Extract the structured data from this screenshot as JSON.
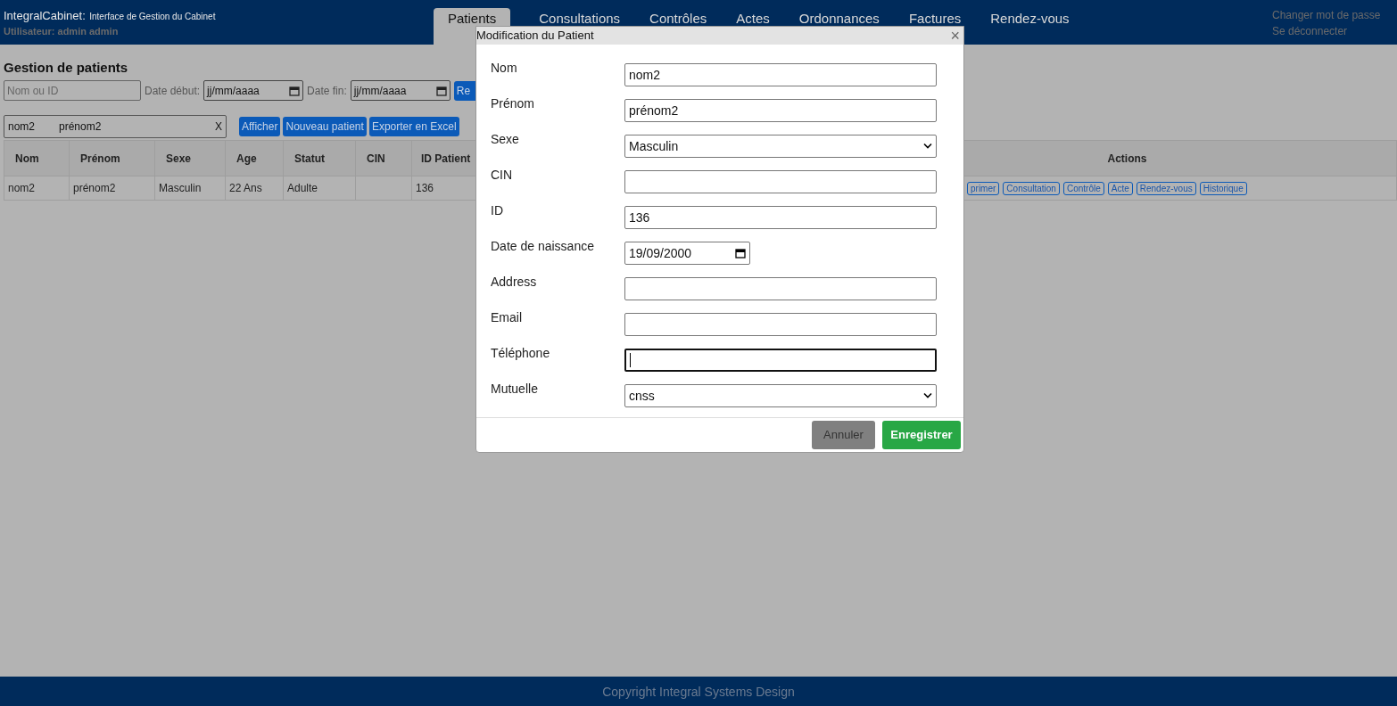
{
  "header": {
    "app_name": "IntegralCabinet:",
    "subtitle": "Interface de Gestion du Cabinet",
    "user": "Utilisateur: admin admin"
  },
  "tabs": [
    {
      "label": "Patients",
      "selected": true
    },
    {
      "label": "Consultations",
      "selected": false
    },
    {
      "label": "Contrôles",
      "selected": false
    },
    {
      "label": "Actes",
      "selected": false
    },
    {
      "label": "Ordonnances",
      "selected": false
    },
    {
      "label": "Factures",
      "selected": false
    },
    {
      "label": "Rendez-vous",
      "selected": false
    }
  ],
  "account_links": [
    "Changer mot de passe",
    "Se déconnecter"
  ],
  "page_title": "Gestion de patients",
  "filters": {
    "search_placeholder": "Nom ou ID",
    "start_label": "Date début:",
    "start_value": "jj/mm/aaaa",
    "end_label": "Date fin:",
    "end_value": "jj/mm/aaaa",
    "button": "Re"
  },
  "selection": {
    "nom": "nom2",
    "prenom": "prénom2",
    "clear": "X"
  },
  "toolbar_buttons": [
    "Afficher",
    "Nouveau patient",
    "Exporter en Excel"
  ],
  "table": {
    "columns": [
      "Nom",
      "Prénom",
      "Sexe",
      "Age",
      "Statut",
      "CIN",
      "ID Patient",
      "Actions"
    ],
    "rows": [
      {
        "cells": [
          "nom2",
          "prénom2",
          "Masculin",
          "22 Ans",
          "Adulte",
          "",
          "136"
        ],
        "actions": [
          "primer",
          "Consultation",
          "Contrôle",
          "Acte",
          "Rendez-vous",
          "Historique"
        ]
      }
    ]
  },
  "modal": {
    "title": "Modification du Patient",
    "close": "×",
    "fields": [
      {
        "label": "Nom",
        "kind": "text",
        "value": "nom2",
        "focused": false
      },
      {
        "label": "Prénom",
        "kind": "text",
        "value": "prénom2",
        "focused": false
      },
      {
        "label": "Sexe",
        "kind": "select",
        "value": "Masculin",
        "focused": false
      },
      {
        "label": "CIN",
        "kind": "text",
        "focused": false
      },
      {
        "label": "ID",
        "kind": "text",
        "value": "136",
        "focused": false
      },
      {
        "label": "Date de naissance",
        "kind": "date",
        "value": "19/09/2000",
        "focused": false
      },
      {
        "label": "Address",
        "kind": "text",
        "focused": false
      },
      {
        "label": "Email",
        "kind": "text",
        "focused": false
      },
      {
        "label": "Téléphone",
        "kind": "text",
        "focused": true
      },
      {
        "label": "Mutuelle",
        "kind": "select",
        "value": "cnss",
        "focused": false
      }
    ],
    "cancel": "Annuler",
    "save": "Enregistrer"
  },
  "footer": "Copyright Integral Systems Design"
}
